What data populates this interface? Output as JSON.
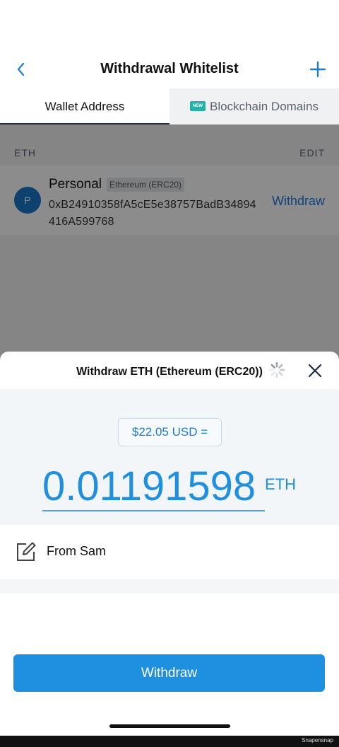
{
  "nav": {
    "title": "Withdrawal Whitelist",
    "back_icon": "chevron-left-icon",
    "add_icon": "plus-icon",
    "accent": "#1f7bd8"
  },
  "tabs": [
    {
      "label": "Wallet Address",
      "active": true
    },
    {
      "label": "Blockchain Domains",
      "active": false,
      "badge": "NEW"
    }
  ],
  "list": {
    "section_label": "ETH",
    "edit_label": "EDIT",
    "entries": [
      {
        "avatar_letter": "P",
        "name": "Personal",
        "network": "Ethereum (ERC20)",
        "address": "0xB24910358fA5cE5e38757BadB34894416A599768",
        "action": "Withdraw"
      }
    ]
  },
  "sheet": {
    "title": "Withdraw ETH (Ethereum (ERC20))",
    "spinner_icon": "loading-spinner-icon",
    "close_icon": "close-icon",
    "usd_value": "$22.05 USD =",
    "eth_amount": "0.01191598",
    "eth_unit": "ETH",
    "memo_icon": "edit-note-icon",
    "memo": "From Sam",
    "withdraw_label": "Withdraw",
    "primary_color": "#1f8fe0"
  },
  "watermark": "Snapensnap"
}
